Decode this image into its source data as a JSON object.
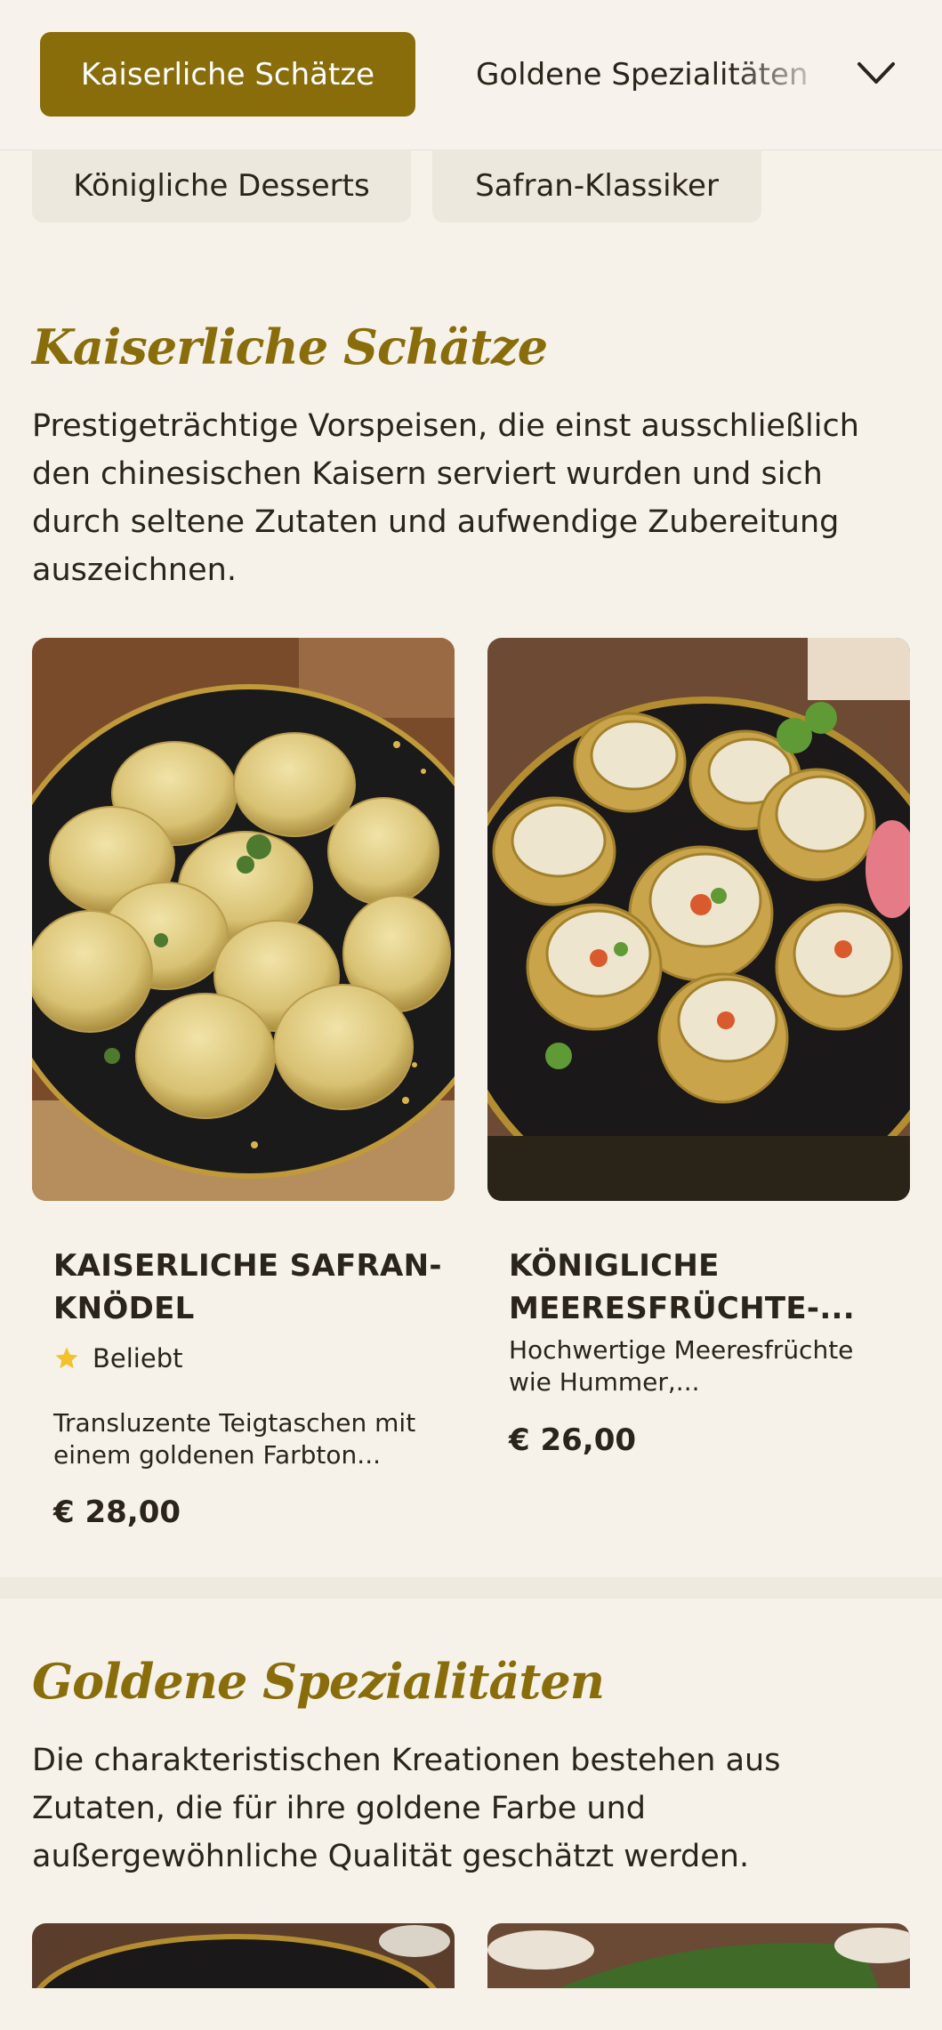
{
  "nav": {
    "active_category": "Kaiserliche Schätze",
    "next_category": "Goldene Spezialitäten",
    "second_row": [
      "Königliche Desserts",
      "Safran-Klassiker"
    ]
  },
  "sections": [
    {
      "title": "Kaiserliche Schätze",
      "description": "Prestigeträchtige Vorspeisen, die einst ausschließlich den chinesischen Kaisern serviert wurden und sich durch seltene Zutaten und aufwendige Zubereitung auszeichnen.",
      "items": [
        {
          "title_line1": "KAISERLICHE SAFRAN-",
          "title_line2": "KNÖDEL",
          "badge": "Beliebt",
          "desc_line1": "Transluzente Teigtaschen mit",
          "desc_line2": "einem goldenen Farbton...",
          "price": "€ 28,00"
        },
        {
          "title_line1": "KÖNIGLICHE",
          "title_line2": "MEERESFRÜCHTE-...",
          "desc_line1": "Hochwertige Meeresfrüchte",
          "desc_line2": "wie Hummer,...",
          "price": "€ 26,00"
        }
      ]
    },
    {
      "title": "Goldene Spezialitäten",
      "description": "Die charakteristischen Kreationen bestehen aus Zutaten, die für ihre goldene Farbe und außergewöhnliche Qualität geschätzt werden."
    }
  ],
  "colors": {
    "accent": "#8a6d0b",
    "background": "#f6f2ea",
    "pill": "#ece8dd",
    "star": "#f2c12e"
  },
  "icons": [
    "chevron-down-icon",
    "star-icon"
  ]
}
